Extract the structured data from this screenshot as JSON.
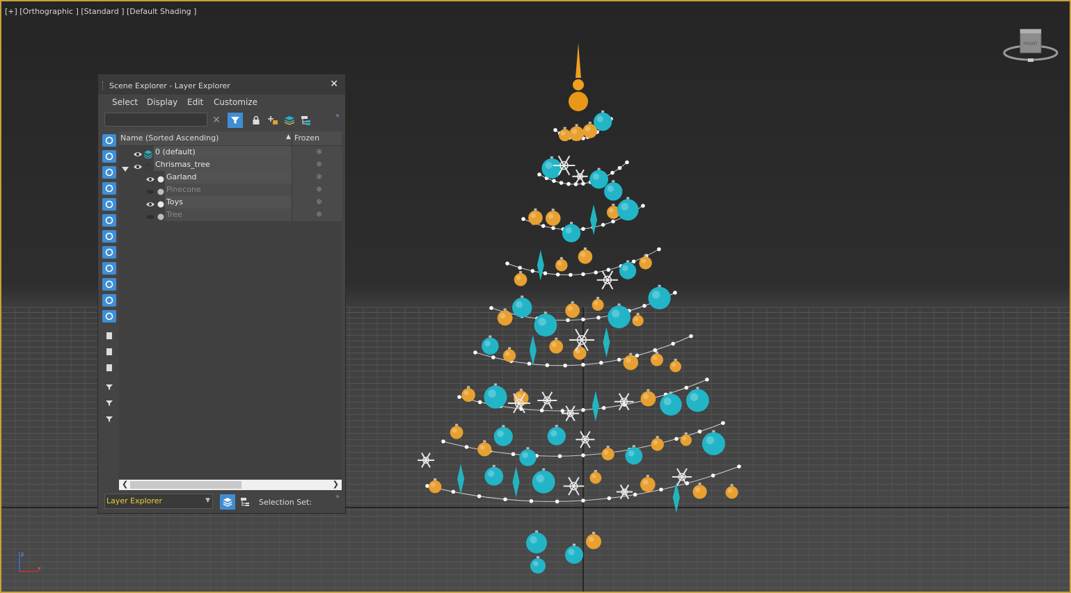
{
  "viewport": {
    "label": "[+] [Orthographic ] [Standard ] [Default Shading ]",
    "viewcube_face": "FRONT",
    "accent": "#c8a23c"
  },
  "explorer": {
    "title": "Scene Explorer - Layer Explorer",
    "close_glyph": "✕",
    "menu": [
      "Select",
      "Display",
      "Edit",
      "Customize"
    ],
    "search_value": "",
    "columns": {
      "name": "Name (Sorted Ascending)",
      "sort_glyph": "▲",
      "frozen": "Frozen"
    },
    "rows": [
      {
        "name": "0 (default)",
        "kind": "layer",
        "visible": true,
        "dim": false
      },
      {
        "name": "Chrismas_tree",
        "kind": "layer-parent",
        "visible": true,
        "dim": false
      },
      {
        "name": "Garland",
        "kind": "child",
        "visible": true,
        "dim": false
      },
      {
        "name": "Pinecone",
        "kind": "child",
        "visible": false,
        "dim": true
      },
      {
        "name": "Toys",
        "kind": "child",
        "visible": true,
        "dim": false
      },
      {
        "name": "Tree",
        "kind": "child",
        "visible": false,
        "dim": true
      }
    ],
    "frozen_glyph": "❄",
    "bottom": {
      "explorer_mode": "Layer Explorer",
      "selection_set_label": "Selection Set:"
    },
    "more_glyph": "»",
    "icons": [
      "filter-icon",
      "lock-icon",
      "add-layer-icon",
      "layers-icon",
      "hierarchy-icon",
      "close-icon",
      "eye-icon",
      "snowflake-icon"
    ],
    "active_color": "#3f8ed4"
  }
}
